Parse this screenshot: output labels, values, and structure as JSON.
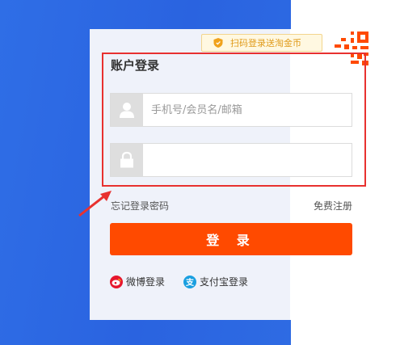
{
  "promo": {
    "text": "扫码登录送淘金币",
    "icon": "shield-icon"
  },
  "login": {
    "title": "账户登录",
    "username_placeholder": "手机号/会员名/邮箱",
    "username_value": "",
    "password_value": "",
    "forgot_label": "忘记登录密码",
    "register_label": "免费注册",
    "submit_label": "登 录"
  },
  "alt_login": [
    {
      "label": "微博登录",
      "icon": "weibo-icon",
      "color": "#e6162d"
    },
    {
      "label": "支付宝登录",
      "icon": "alipay-icon",
      "color": "#1a9fe0"
    }
  ],
  "colors": {
    "accent": "#ff4a00",
    "background_blue": "#2f6ee6",
    "highlight_red": "#e8312f",
    "promo_text": "#e09b1b"
  }
}
